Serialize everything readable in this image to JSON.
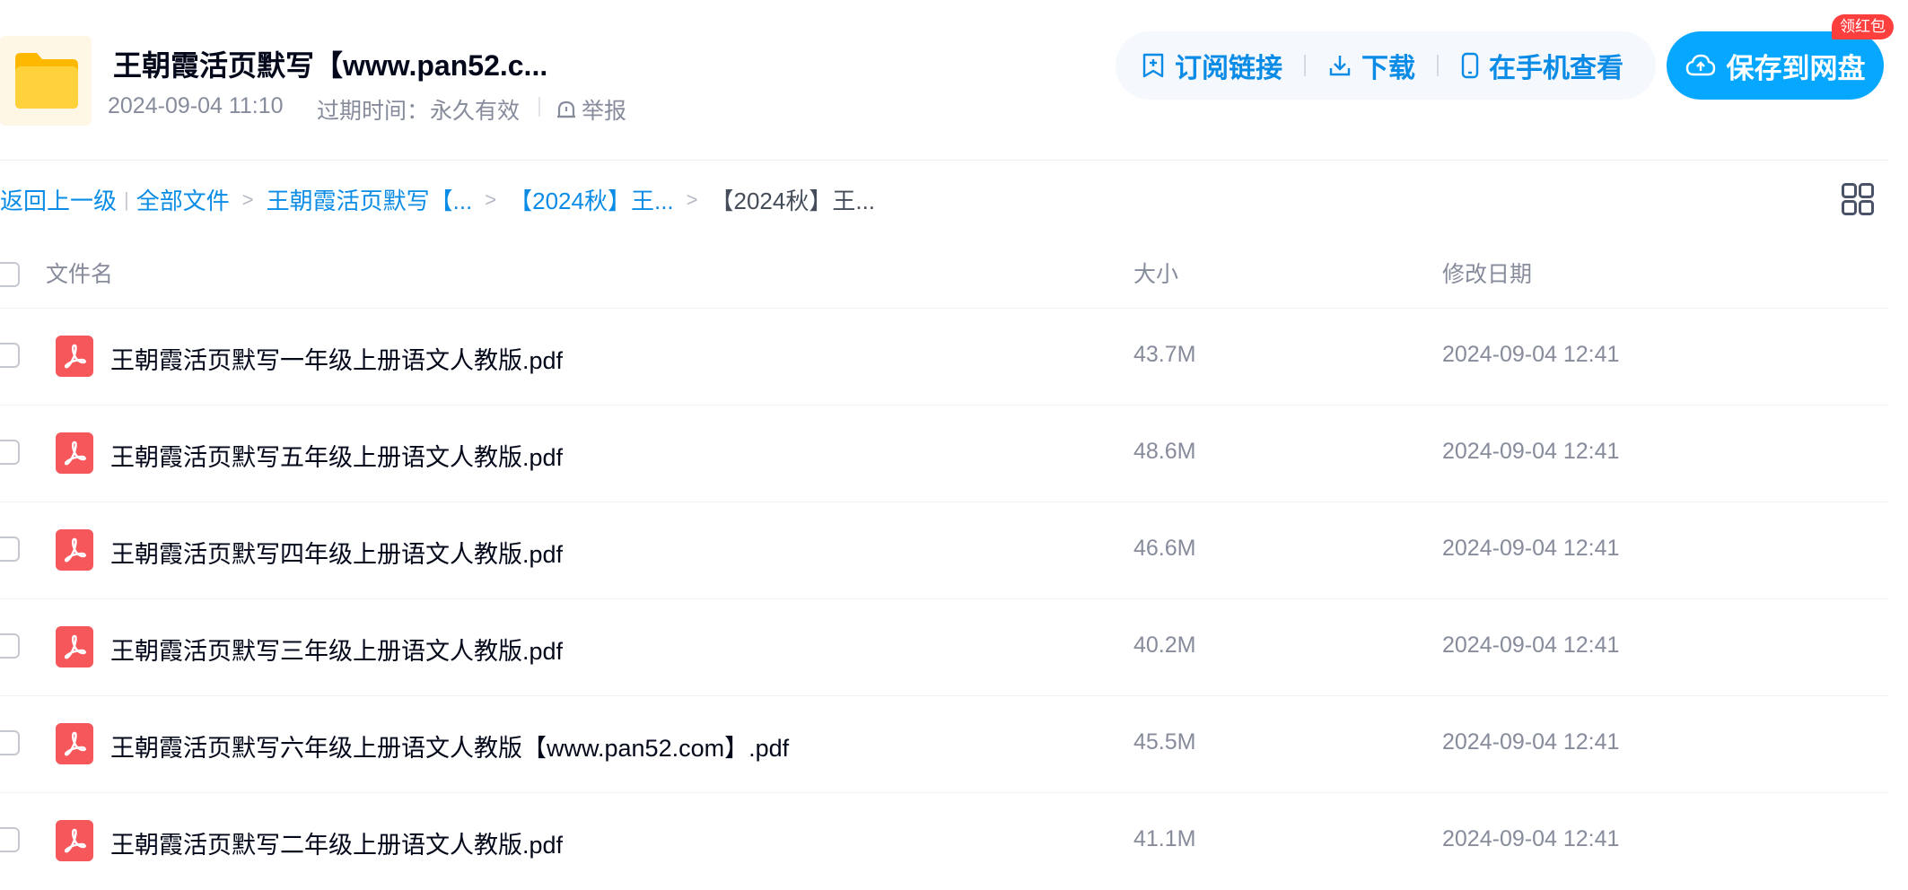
{
  "header": {
    "title": "王朝霞活页默写【www.pan52.c...",
    "date": "2024-09-04 11:10",
    "expire_label": "过期时间：",
    "expire_value": "永久有效",
    "report": "举报"
  },
  "actions": {
    "subscribe": "订阅链接",
    "download": "下载",
    "phone": "在手机查看",
    "save": "保存到网盘",
    "badge": "领红包"
  },
  "breadcrumb": {
    "back": "返回上一级",
    "all_files": "全部文件",
    "level1": "王朝霞活页默写【...",
    "level2": "【2024秋】王...",
    "current": "【2024秋】王..."
  },
  "table": {
    "columns": {
      "name": "文件名",
      "size": "大小",
      "date": "修改日期"
    },
    "rows": [
      {
        "name": "王朝霞活页默写一年级上册语文人教版.pdf",
        "size": "43.7M",
        "date": "2024-09-04 12:41"
      },
      {
        "name": "王朝霞活页默写五年级上册语文人教版.pdf",
        "size": "48.6M",
        "date": "2024-09-04 12:41"
      },
      {
        "name": "王朝霞活页默写四年级上册语文人教版.pdf",
        "size": "46.6M",
        "date": "2024-09-04 12:41"
      },
      {
        "name": "王朝霞活页默写三年级上册语文人教版.pdf",
        "size": "40.2M",
        "date": "2024-09-04 12:41"
      },
      {
        "name": "王朝霞活页默写六年级上册语文人教版【www.pan52.com】.pdf",
        "size": "45.5M",
        "date": "2024-09-04 12:41"
      },
      {
        "name": "王朝霞活页默写二年级上册语文人教版.pdf",
        "size": "41.1M",
        "date": "2024-09-04 12:41"
      }
    ]
  },
  "colors": {
    "accent": "#06a7ff",
    "link": "#0a8ce6",
    "pdf_icon": "#f5575b",
    "folder": "#ffc926",
    "badge": "#ff3e3e"
  },
  "icons": {
    "folder": "folder-icon",
    "subscribe": "subscribe-icon",
    "download": "download-icon",
    "phone": "phone-icon",
    "save": "cloud-upload-icon",
    "report": "report-icon",
    "grid": "grid-view-icon",
    "file": "pdf-icon"
  }
}
